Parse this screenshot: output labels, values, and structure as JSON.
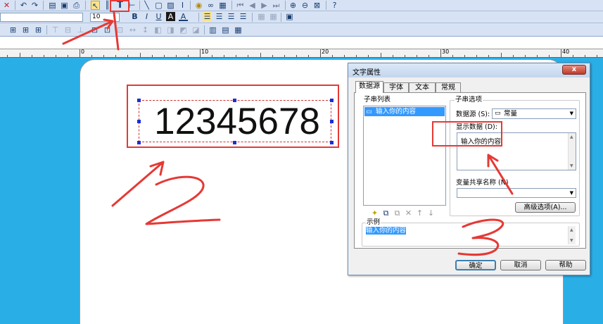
{
  "toolbar": {
    "row1_icons": [
      "close-icon",
      "undo-icon",
      "redo-icon",
      "print-preview-icon",
      "page-setup-icon",
      "print-icon",
      "pointer-icon",
      "barcode-icon",
      "text-icon",
      "line-tool-icon",
      "line-icon",
      "rect-icon",
      "image-icon",
      "cursor-icon",
      "database-icon",
      "binoculars-icon",
      "form-icon",
      "first-page-icon",
      "prev-page-icon",
      "next-page-icon",
      "last-page-icon",
      "zoom-in-icon",
      "zoom-out-icon",
      "zoom-fit-icon",
      "help-icon"
    ],
    "font_size": "10",
    "text_tool_glyph": "T",
    "bold": "B",
    "italic": "I",
    "underline": "U",
    "highlight": "A",
    "fontcolor": "A"
  },
  "ruler": {
    "labels": [
      "0",
      "10",
      "20",
      "30",
      "40"
    ]
  },
  "label": {
    "barcode_text": "12345678"
  },
  "annotations": {
    "two": "2",
    "three": "3",
    "one": "1"
  },
  "dialog": {
    "title": "文字属性",
    "close": "x",
    "tabs": [
      "数据源",
      "字体",
      "文本",
      "常规"
    ],
    "substring_list_label": "子串列表",
    "substring_item": "输入你的内容",
    "substring_options_label": "子串选项",
    "datasource_label": "数据源 (S):",
    "datasource_value": "常量",
    "display_data_label": "显示数据 (D):",
    "display_data_value": "输入你的内容",
    "shared_name_label": "变量共享名称 (N)",
    "advanced_button": "高级选项(A)...",
    "example_label": "示例",
    "example_value": "输入你的内容",
    "ok": "确定",
    "cancel": "取消",
    "help": "帮助"
  },
  "colors": {
    "accent_red": "#e53935",
    "canvas_bg": "#2aaee6",
    "selection_blue": "#1b2ed8"
  }
}
